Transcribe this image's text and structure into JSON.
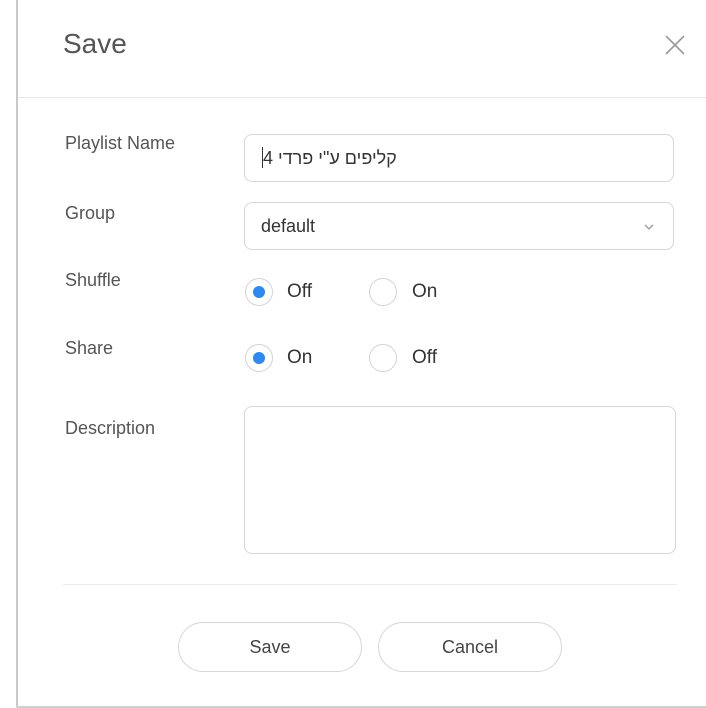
{
  "dialog": {
    "title": "Save",
    "close_icon": "close-icon"
  },
  "form": {
    "playlist_name": {
      "label": "Playlist Name",
      "value": "קליפים ע\"י פרדי 4"
    },
    "group": {
      "label": "Group",
      "value": "default",
      "icon": "chevron-down-icon"
    },
    "shuffle": {
      "label": "Shuffle",
      "options": [
        {
          "label": "Off",
          "checked": true
        },
        {
          "label": "On",
          "checked": false
        }
      ]
    },
    "share": {
      "label": "Share",
      "options": [
        {
          "label": "On",
          "checked": true
        },
        {
          "label": "Off",
          "checked": false
        }
      ]
    },
    "description": {
      "label": "Description",
      "value": ""
    }
  },
  "buttons": {
    "save": "Save",
    "cancel": "Cancel"
  },
  "colors": {
    "accent": "#2f87f0",
    "border": "#d6d6d6"
  }
}
